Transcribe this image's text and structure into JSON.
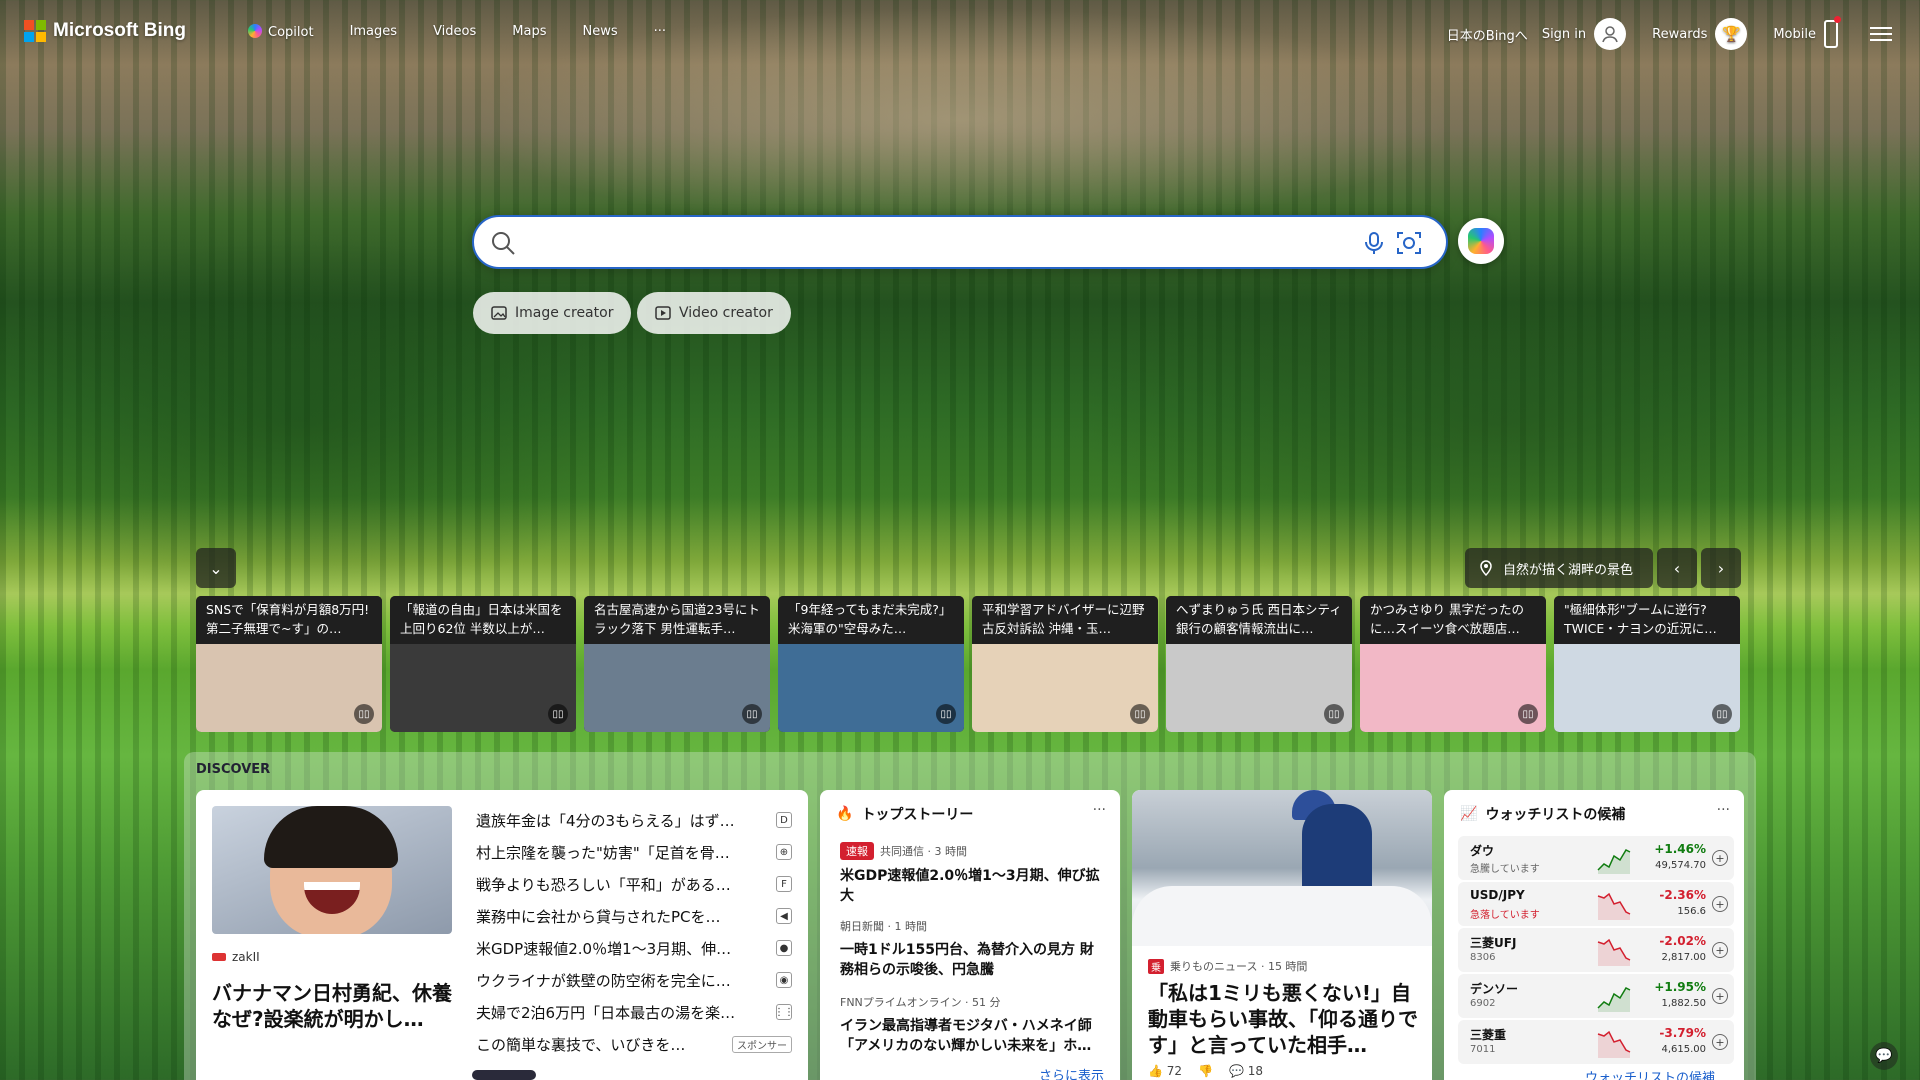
{
  "header": {
    "brand": "Microsoft Bing",
    "nav": [
      "Copilot",
      "Images",
      "Videos",
      "Maps",
      "News",
      "···"
    ],
    "region": "日本のBingへ",
    "signin": "Sign in",
    "rewards": "Rewards",
    "mobile": "Mobile"
  },
  "search": {
    "value": "",
    "placeholder": ""
  },
  "pills": {
    "image_creator": "Image creator",
    "video_creator": "Video creator"
  },
  "carousel": {
    "location_label": "自然が描く湖畔の景色",
    "cards": [
      {
        "caption": "SNSで「保育料が月額8万円! 第二子無理で~す」の…",
        "thumb": "#d9c4b0"
      },
      {
        "caption": "「報道の自由」日本は米国を上回り62位 半数以上が…",
        "thumb": "#3a3a3a"
      },
      {
        "caption": "名古屋高速から国道23号にトラック落下 男性運転手…",
        "thumb": "#6b7d8f"
      },
      {
        "caption": "「9年経ってもまだ未完成?」米海軍の\"空母みた…",
        "thumb": "#3f6d96"
      },
      {
        "caption": "平和学習アドバイザーに辺野古反対訴訟 沖縄・玉…",
        "thumb": "#e6d2b8"
      },
      {
        "caption": "へずまりゅう氏 西日本シティ銀行の顧客情報流出に…",
        "thumb": "#c9c9c9"
      },
      {
        "caption": "かつみさゆり 黒字だったのに…スイーツ食べ放題店…",
        "thumb": "#f2b8c6"
      },
      {
        "caption": "\"極細体形\"ブームに逆行? TWICE・ナヨンの近況に…",
        "thumb": "#cfd9e3"
      }
    ]
  },
  "discover": {
    "title": "DISCOVER",
    "feature": {
      "source": "zakII",
      "headline": "バナナマン日村勇紀、休養なぜ?設楽統が明かし…"
    },
    "list": [
      {
        "text": "遺族年金は「4分の3もらえる」はず…",
        "icon": "D"
      },
      {
        "text": "村上宗隆を襲った\"妨害\"「足首を骨…",
        "icon": "⊕"
      },
      {
        "text": "戦争よりも恐ろしい「平和」がある…",
        "icon": "F"
      },
      {
        "text": "業務中に会社から貸与されたPCを…",
        "icon": "◀"
      },
      {
        "text": "米GDP速報値2.0％増1～3月期、伸…",
        "icon": "●"
      },
      {
        "text": "ウクライナが鉄壁の防空術を完全に…",
        "icon": "◉"
      },
      {
        "text": "夫婦で2泊6万円「日本最古の湯を楽…",
        "icon": "⋮⋮"
      },
      {
        "text": "この簡単な裏技で、いびきを…",
        "icon": "",
        "sponsor": "スポンサー"
      }
    ],
    "top_stories": {
      "title": "トップストーリー",
      "see_more": "さらに表示",
      "stories": [
        {
          "badge": "速報",
          "source": "共同通信 · 3 時間",
          "headline": "米GDP速報値2.0％増1～3月期、伸び拡大"
        },
        {
          "source": "朝日新聞 · 1 時間",
          "headline": "一時1ドル155円台、為替介入の見方 財務相らの示唆後、円急騰"
        },
        {
          "source": "FNNプライムオンライン · 51 分",
          "headline": "イラン最高指導者モジタバ・ハメネイ師「アメリカのない輝かしい未来を」ホ…"
        }
      ]
    },
    "news_card": {
      "source": "乗りものニュース · 15 時間",
      "headline": "「私は1ミリも悪くない!」自動車もらい事故、「仰る通りです」と言っていた相手…",
      "likes": "72",
      "comments": "18"
    },
    "watchlist": {
      "title": "ウォッチリストの候補",
      "link": "ウォッチリストの候補…",
      "items": [
        {
          "name": "ダウ",
          "sub": "急騰しています",
          "change": "+1.46%",
          "value": "49,574.70",
          "dir": "up"
        },
        {
          "name": "USD/JPY",
          "sub": "急落しています",
          "change": "-2.36%",
          "value": "156.6",
          "dir": "down"
        },
        {
          "name": "三菱UFJ",
          "sub": "8306",
          "change": "-2.02%",
          "value": "2,817.00",
          "dir": "down"
        },
        {
          "name": "デンソー",
          "sub": "6902",
          "change": "+1.95%",
          "value": "1,882.50",
          "dir": "up"
        },
        {
          "name": "三菱重",
          "sub": "7011",
          "change": "-3.79%",
          "value": "4,615.00",
          "dir": "down"
        }
      ]
    }
  }
}
